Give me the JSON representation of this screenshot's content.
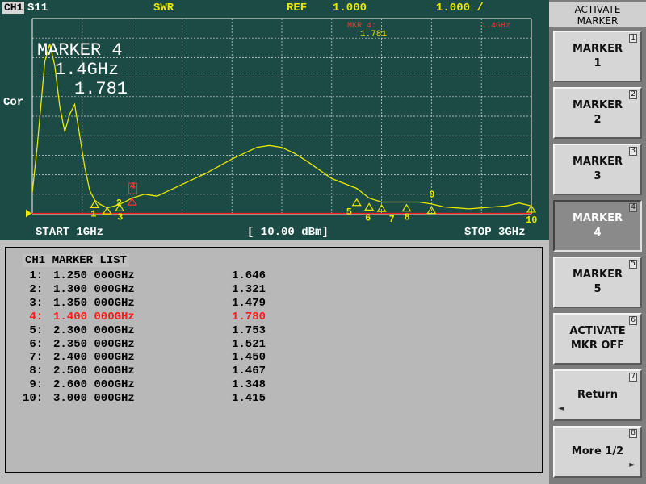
{
  "status_bar": {
    "channel": "CH1",
    "parameter": "S11",
    "format": "SWR",
    "ref_label": "REF",
    "ref_value": "1.000",
    "scale": "1.000 /",
    "mkr_label": "MKR 4:",
    "mkr_value": "1.781",
    "mkr_freq": "1.4GHz"
  },
  "plot": {
    "cor_label": "Cor",
    "marker_readout": {
      "name": "MARKER 4",
      "freq": "1.4GHz",
      "value": "1.781"
    },
    "start": "START 1GHz",
    "power": "[ 10.00 dBm]",
    "stop": "STOP 3GHz",
    "trace_color": "#e8e800",
    "grid_color": "#d8d8d8",
    "ref_line_color": "#ff2020"
  },
  "chart_data": {
    "type": "line",
    "x_unit": "GHz",
    "xlim": [
      1.0,
      3.0
    ],
    "ylim": [
      1.0,
      11.0
    ],
    "series": [
      {
        "x": [
          1.0,
          1.02,
          1.05,
          1.07,
          1.09,
          1.11,
          1.13,
          1.15,
          1.17,
          1.19,
          1.21,
          1.23,
          1.25,
          1.27,
          1.3,
          1.33,
          1.35,
          1.37,
          1.4,
          1.45,
          1.5,
          1.6,
          1.7,
          1.8,
          1.9,
          1.95,
          2.0,
          2.05,
          2.1,
          2.2,
          2.3,
          2.35,
          2.4,
          2.45,
          2.5,
          2.55,
          2.6,
          2.65,
          2.7,
          2.75,
          2.8,
          2.85,
          2.9,
          2.95,
          3.0
        ],
        "y": [
          2.1,
          4.5,
          8.8,
          9.7,
          8.6,
          6.5,
          5.2,
          6.1,
          6.6,
          5.0,
          3.4,
          2.2,
          1.7,
          1.5,
          1.3,
          1.4,
          1.5,
          1.6,
          1.8,
          2.0,
          1.9,
          2.5,
          3.1,
          3.8,
          4.4,
          4.5,
          4.4,
          4.1,
          3.7,
          2.8,
          2.3,
          1.8,
          1.6,
          1.6,
          1.6,
          1.6,
          1.5,
          1.35,
          1.3,
          1.25,
          1.3,
          1.35,
          1.4,
          1.55,
          1.4
        ]
      }
    ],
    "markers": [
      {
        "id": "1",
        "x": 1.25,
        "y": 1.646
      },
      {
        "id": "2",
        "x": 1.3,
        "y": 1.321
      },
      {
        "id": "3",
        "x": 1.35,
        "y": 1.479
      },
      {
        "id": "4",
        "x": 1.4,
        "y": 1.78
      },
      {
        "id": "5",
        "x": 2.3,
        "y": 1.753
      },
      {
        "id": "6",
        "x": 2.35,
        "y": 1.521
      },
      {
        "id": "7",
        "x": 2.4,
        "y": 1.45
      },
      {
        "id": "8",
        "x": 2.5,
        "y": 1.467
      },
      {
        "id": "9",
        "x": 2.6,
        "y": 1.348
      },
      {
        "id": "10",
        "x": 3.0,
        "y": 1.415
      }
    ]
  },
  "marker_list": {
    "title": "CH1 MARKER LIST",
    "rows": [
      {
        "idx": " 1:",
        "freq": "1.250 000GHz",
        "value": "1.646",
        "active": false
      },
      {
        "idx": " 2:",
        "freq": "1.300 000GHz",
        "value": "1.321",
        "active": false
      },
      {
        "idx": " 3:",
        "freq": "1.350 000GHz",
        "value": "1.479",
        "active": false
      },
      {
        "idx": " 4:",
        "freq": "1.400 000GHz",
        "value": "1.780",
        "active": true
      },
      {
        "idx": " 5:",
        "freq": "2.300 000GHz",
        "value": "1.753",
        "active": false
      },
      {
        "idx": " 6:",
        "freq": "2.350 000GHz",
        "value": "1.521",
        "active": false
      },
      {
        "idx": " 7:",
        "freq": "2.400 000GHz",
        "value": "1.450",
        "active": false
      },
      {
        "idx": " 8:",
        "freq": "2.500 000GHz",
        "value": "1.467",
        "active": false
      },
      {
        "idx": " 9:",
        "freq": "2.600 000GHz",
        "value": "1.348",
        "active": false
      },
      {
        "idx": "10:",
        "freq": "3.000 000GHz",
        "value": "1.415",
        "active": false
      }
    ]
  },
  "softkeys": {
    "title_line1": "ACTIVATE",
    "title_line2": "MARKER",
    "keys": [
      {
        "line1": "MARKER",
        "line2": "1",
        "num": "1",
        "active": false
      },
      {
        "line1": "MARKER",
        "line2": "2",
        "num": "2",
        "active": false
      },
      {
        "line1": "MARKER",
        "line2": "3",
        "num": "3",
        "active": false
      },
      {
        "line1": "MARKER",
        "line2": "4",
        "num": "4",
        "active": true
      },
      {
        "line1": "MARKER",
        "line2": "5",
        "num": "5",
        "active": false
      },
      {
        "line1": "ACTIVATE",
        "line2": "MKR OFF",
        "num": "6",
        "active": false
      },
      {
        "line1": "Return",
        "line2": "",
        "num": "7",
        "active": false,
        "arrow": "◄"
      },
      {
        "line1": "More 1/2",
        "line2": "",
        "num": "8",
        "active": false,
        "arrow": "►"
      }
    ]
  }
}
